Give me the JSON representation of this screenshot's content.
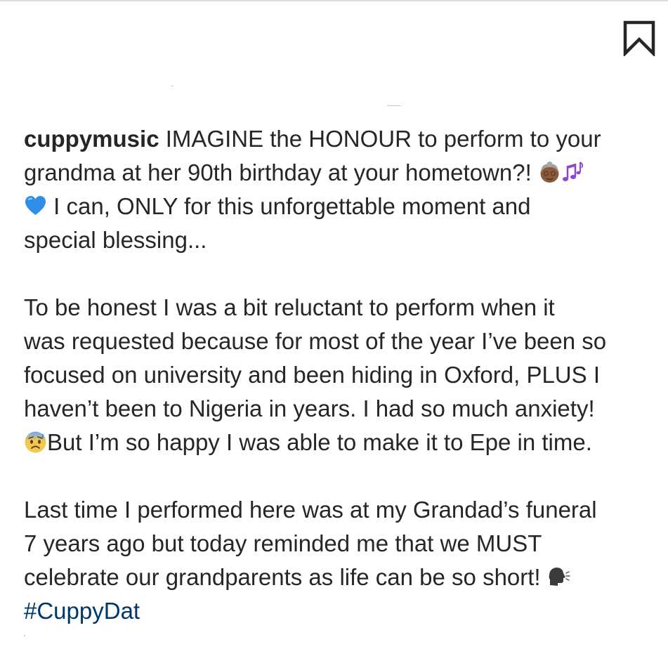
{
  "post": {
    "username": "cuppymusic",
    "paragraphs": [
      {
        "lines": [
          {
            "text": " IMAGINE the HONOUR to perform to your"
          },
          {
            "text": "grandma at her 90th birthday at your hometown?! "
          },
          {
            "text": " I can, ONLY for this unforgettable moment and"
          },
          {
            "text": "special blessing..."
          }
        ]
      },
      {
        "lines": [
          {
            "text": "To be honest I was a bit reluctant to perform when it"
          },
          {
            "text": "was requested because for most of the year I’ve been so"
          },
          {
            "text": "focused on university and been hiding in Oxford, PLUS I"
          },
          {
            "text": "haven’t been to Nigeria in years. I had so much anxiety!"
          },
          {
            "text": "But I’m so happy I was able to make it to Epe in time."
          }
        ]
      },
      {
        "lines": [
          {
            "text": "Last time I performed here was at my Grandad’s funeral"
          },
          {
            "text": "7 years ago but today reminded me that we MUST"
          },
          {
            "text": "celebrate our grandparents as life can be so short! "
          }
        ],
        "hashtag": "#CuppyDat"
      }
    ]
  },
  "icons": {
    "bookmark": "bookmark-icon",
    "emoji_grandma": "old-woman-emoji",
    "emoji_notes": "musical-notes-emoji",
    "emoji_heart": "blue-heart-emoji",
    "emoji_anxious": "anxious-face-with-sweat-emoji",
    "emoji_speaking": "speaking-head-emoji"
  },
  "colors": {
    "text": "#262626",
    "hashtag": "#00376b",
    "heart": "#2f8ee8",
    "notes": "#8e44d4"
  }
}
